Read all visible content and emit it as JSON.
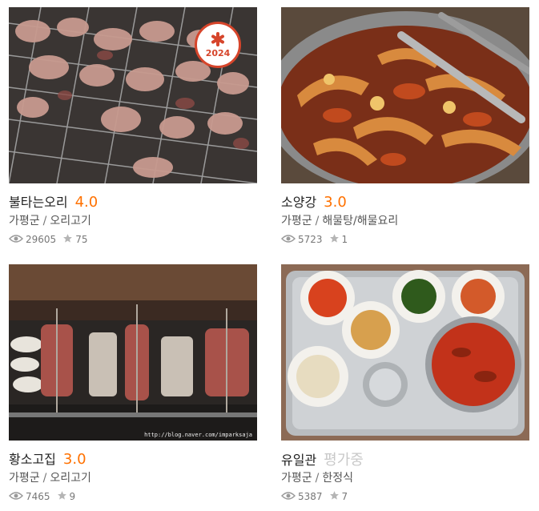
{
  "restaurants": [
    {
      "name": "불타는오리",
      "score": "4.0",
      "region": "가평군",
      "category": "오리고기",
      "views": "29605",
      "stars": "75",
      "badge_year": "2024"
    },
    {
      "name": "소양강",
      "score": "3.0",
      "region": "가평군",
      "category": "해물탕/해물요리",
      "views": "5723",
      "stars": "1"
    },
    {
      "name": "황소고집",
      "score": "3.0",
      "region": "가평군",
      "category": "오리고기",
      "views": "7465",
      "stars": "9",
      "watermark": "http://blog.naver.com/imparksaja"
    },
    {
      "name": "유일관",
      "score": "평가중",
      "region": "가평군",
      "category": "한정식",
      "views": "5387",
      "stars": "7"
    }
  ],
  "separator": "/",
  "icons": {
    "views": "eye-icon",
    "stars": "star-icon",
    "badge": "asterisk-icon"
  },
  "colors": {
    "score": "#ff7100",
    "score_pending": "#c8c8c8",
    "badge": "#d6452b"
  }
}
